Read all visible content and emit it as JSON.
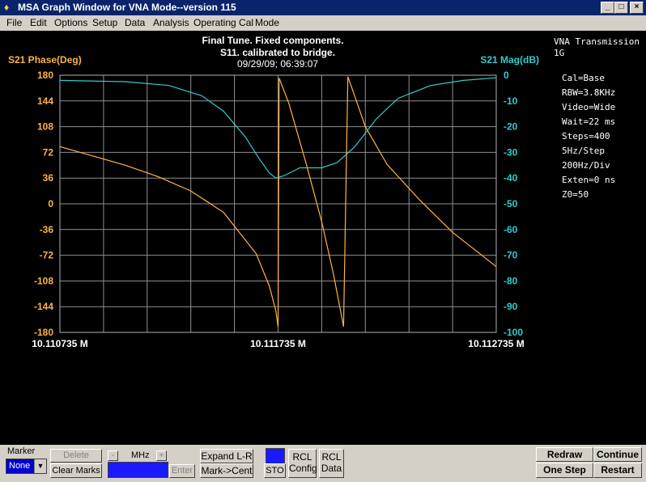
{
  "window": {
    "title": "MSA Graph Window for VNA Mode--version 115",
    "minimize": "_",
    "maximize": "□",
    "close": "×"
  },
  "menu": [
    "File",
    "Edit",
    "Options",
    "Setup",
    "Data",
    "Analysis",
    "Operating Cal",
    "Mode"
  ],
  "header": {
    "line1": "Final Tune. Fixed components.",
    "line2": "S11.  calibrated to bridge.",
    "line3": "09/29/09; 06:39:07"
  },
  "info": {
    "mode": "VNA Transmission",
    "path": "1G",
    "settings": [
      "Cal=Base",
      "RBW=3.8KHz",
      "Video=Wide",
      "Wait=22 ms",
      "Steps=400",
      "5Hz/Step",
      "200Hz/Div",
      "Exten=0 ns",
      "Z0=50"
    ]
  },
  "colors": {
    "phase": "#ffb347",
    "mag": "#33cccc",
    "grid": "#909090"
  },
  "chart_data": {
    "type": "line",
    "ylabel_left": "S21 Phase(Deg)",
    "ylabel_right": "S21 Mag(dB)",
    "x_ticks": [
      "10.110735 M",
      "10.111735 M",
      "10.112735 M"
    ],
    "xlim": [
      10.110735,
      10.112735
    ],
    "y_left_ticks": [
      180,
      144,
      108,
      72,
      36,
      0,
      -36,
      -72,
      -108,
      -144,
      -180
    ],
    "y_right_ticks": [
      0,
      -10,
      -20,
      -30,
      -40,
      -50,
      -60,
      -70,
      -80,
      -90,
      -100
    ],
    "ylim_left": [
      -180,
      180
    ],
    "ylim_right": [
      -100,
      0
    ],
    "grid": true,
    "series": [
      {
        "name": "S21 Phase(Deg)",
        "axis": "left",
        "x": [
          10.110735,
          10.110885,
          10.111035,
          10.111185,
          10.111335,
          10.111485,
          10.111635,
          10.111695,
          10.111725,
          10.111735,
          10.11174,
          10.111785,
          10.111865,
          10.111935,
          10.11199,
          10.112035,
          10.112055,
          10.112085,
          10.112135,
          10.112235,
          10.112385,
          10.112535,
          10.112735
        ],
        "y": [
          80,
          67,
          54,
          38,
          18,
          -12,
          -70,
          -115,
          -150,
          -172,
          176,
          140,
          55,
          -25,
          -100,
          -172,
          178,
          152,
          108,
          55,
          5,
          -40,
          -88
        ]
      },
      {
        "name": "S21 Mag(dB)",
        "axis": "right",
        "x": [
          10.110735,
          10.111035,
          10.111235,
          10.111385,
          10.111485,
          10.111585,
          10.111645,
          10.111695,
          10.111725,
          10.111765,
          10.111835,
          10.111935,
          10.112005,
          10.112085,
          10.112185,
          10.112285,
          10.112435,
          10.112585,
          10.112735
        ],
        "y": [
          -2,
          -2.5,
          -4,
          -8,
          -14,
          -24,
          -32,
          -38,
          -40,
          -39,
          -36,
          -36,
          -34,
          -28,
          -17,
          -9,
          -4,
          -2,
          -1
        ]
      }
    ]
  },
  "controls": {
    "marker_label": "Marker",
    "marker_value": "None",
    "delete": "Delete",
    "clear_marks": "Clear Marks",
    "minus": "-",
    "plus": "+",
    "unit": "MHz",
    "enter": "Enter",
    "expand": "Expand L-R",
    "mark_cent": "Mark->Cent",
    "sto": "STO",
    "rcl_config_1": "RCL",
    "rcl_config_2": "Config",
    "rcl_data_1": "RCL",
    "rcl_data_2": "Data",
    "redraw": "Redraw",
    "continue": "Continue",
    "one_step": "One Step",
    "restart": "Restart"
  }
}
